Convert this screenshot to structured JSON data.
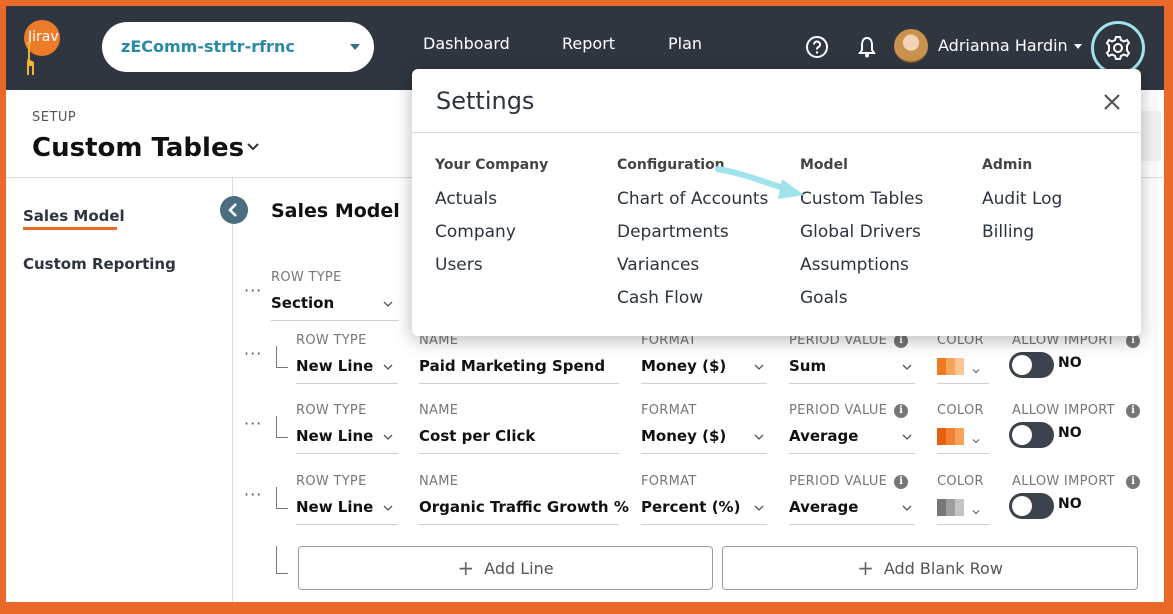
{
  "app": {
    "logo_text": "Jirav",
    "model_select": "zEComm-strtr-rfrnc",
    "nav": [
      "Dashboard",
      "Report",
      "Plan"
    ],
    "user_name": "Adrianna Hardin"
  },
  "page": {
    "setup_label": "SETUP",
    "title": "Custom Tables",
    "section_title": "Sales Model"
  },
  "sidebar": {
    "items": [
      {
        "label": "Sales Model"
      },
      {
        "label": "Custom Reporting"
      }
    ]
  },
  "labels": {
    "row_type": "ROW TYPE",
    "name": "NAME",
    "format": "FORMAT",
    "period_value": "PERIOD VALUE",
    "color": "COLOR",
    "allow_import": "ALLOW IMPORT",
    "info": "i"
  },
  "section_row": {
    "row_type": "Section"
  },
  "rows": [
    {
      "row_type": "New Line",
      "name": "Paid Marketing Spend",
      "format": "Money ($)",
      "period_value": "Sum",
      "allow_import": "NO",
      "swatch": [
        "#f07a20",
        "#f6a35b",
        "#f9c692"
      ]
    },
    {
      "row_type": "New Line",
      "name": "Cost per Click",
      "format": "Money ($)",
      "period_value": "Average",
      "allow_import": "NO",
      "swatch": [
        "#e85f12",
        "#f08033",
        "#f6a35b"
      ]
    },
    {
      "row_type": "New Line",
      "name": "Organic Traffic Growth %",
      "format": "Percent (%)",
      "period_value": "Average",
      "allow_import": "NO",
      "swatch": [
        "#777777",
        "#9e9e9e",
        "#c4c4c4"
      ]
    }
  ],
  "buttons": {
    "add_line": "Add Line",
    "add_blank_row": "Add Blank Row",
    "plus": "+"
  },
  "settings_popup": {
    "title": "Settings",
    "columns": [
      {
        "heading": "Your Company",
        "links": [
          "Actuals",
          "Company",
          "Users"
        ]
      },
      {
        "heading": "Configuration",
        "links": [
          "Chart of Accounts",
          "Departments",
          "Variances",
          "Cash Flow"
        ]
      },
      {
        "heading": "Model",
        "links": [
          "Custom Tables",
          "Global Drivers",
          "Assumptions",
          "Goals"
        ]
      },
      {
        "heading": "Admin",
        "links": [
          "Audit Log",
          "Billing"
        ]
      }
    ]
  },
  "colors": {
    "topbar": "#2f3640",
    "accent": "#e8692a",
    "link_teal": "#2a8aa4",
    "highlight": "#9fe3ec"
  }
}
